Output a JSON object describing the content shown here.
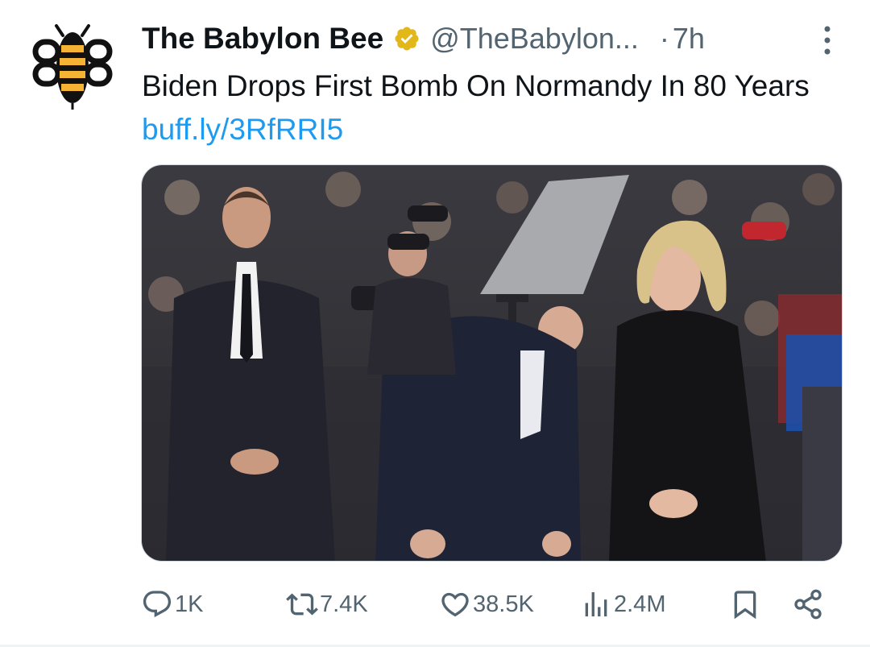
{
  "tweet": {
    "author_name": "The Babylon Bee",
    "handle": "@TheBabylon...",
    "time_separator": "·",
    "time": "7h",
    "text": "Biden Drops First Bomb On Normandy In 80 Years",
    "link": "buff.ly/3RfRRI5"
  },
  "actions": {
    "replies": "1K",
    "reposts": "7.4K",
    "likes": "38.5K",
    "views": "2.4M"
  },
  "colors": {
    "link": "#1d9bf0",
    "secondary_text": "#536471",
    "verified_badge": "#e2b719",
    "bee_yellow": "#f5b335"
  },
  "icons": [
    "babylon-bee-logo",
    "verified-badge-icon",
    "more-options-icon",
    "reply-icon",
    "repost-icon",
    "like-icon",
    "views-icon",
    "bookmark-icon",
    "share-icon"
  ]
}
